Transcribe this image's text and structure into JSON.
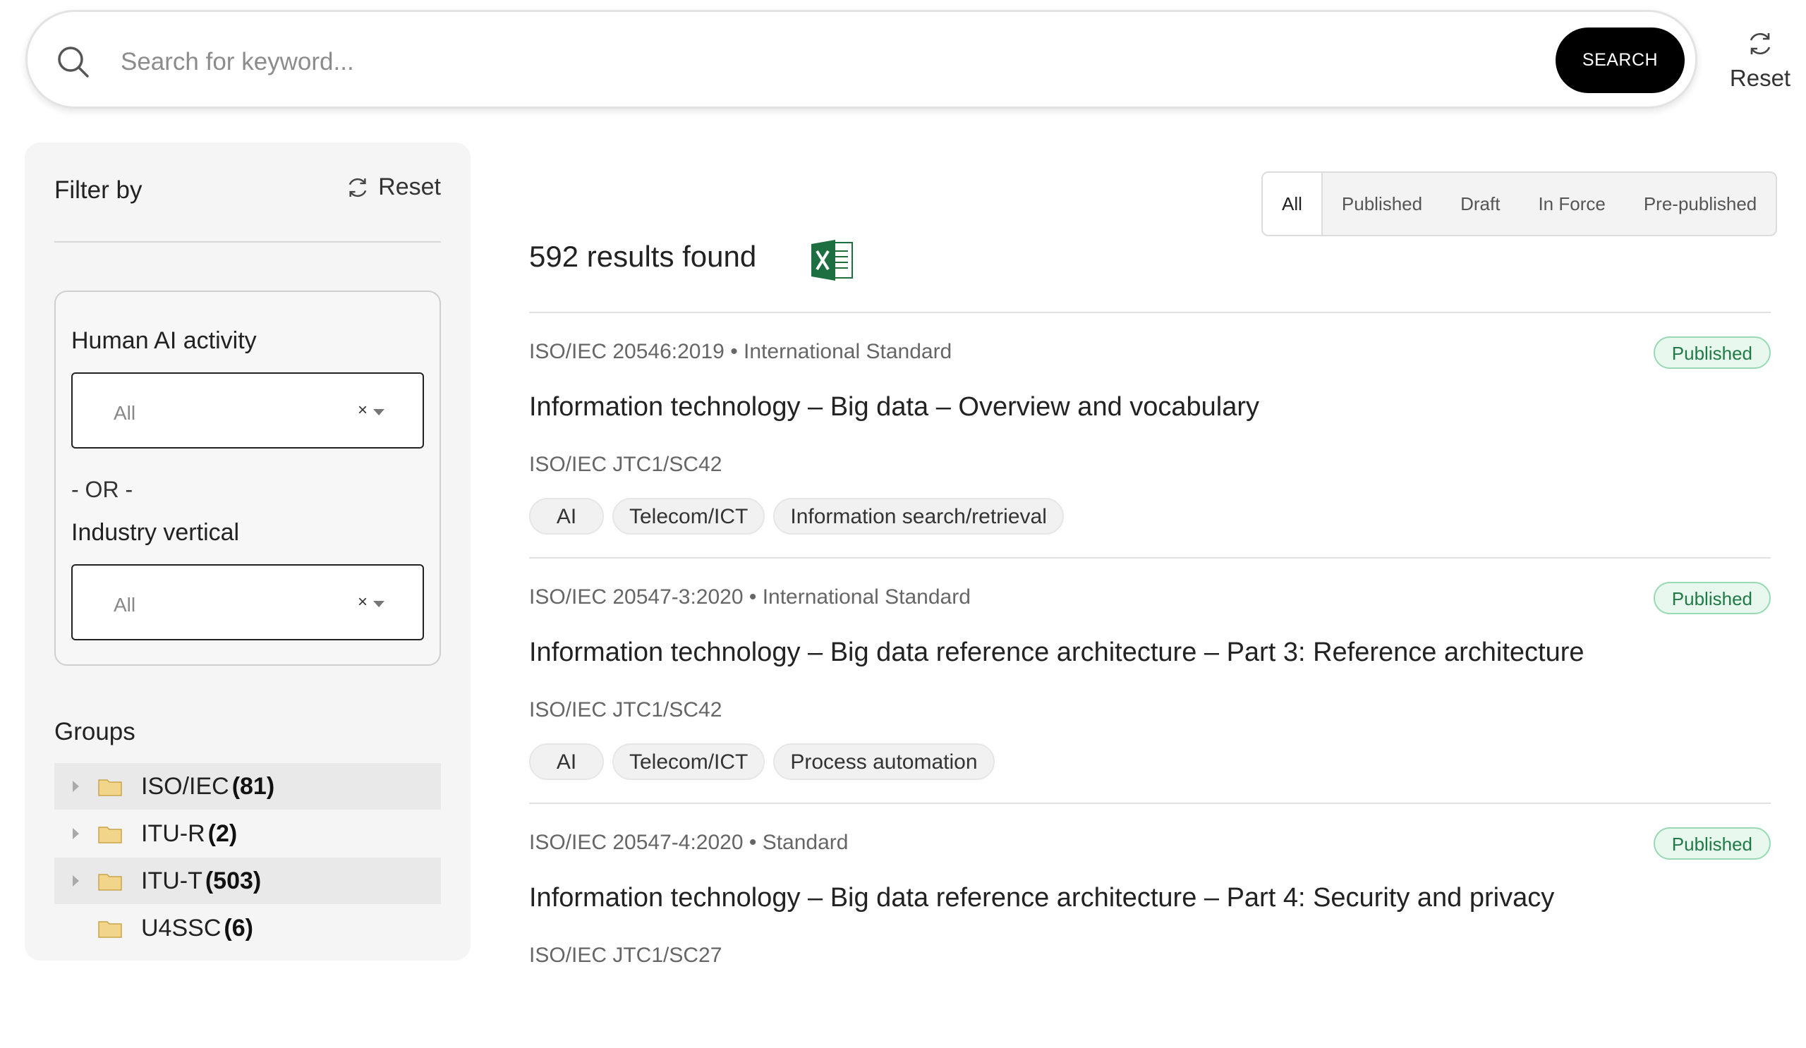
{
  "search": {
    "placeholder": "Search for keyword...",
    "button_label": "SEARCH",
    "reset_label": "Reset"
  },
  "sidebar": {
    "filter_title": "Filter by",
    "reset_label": "Reset",
    "human_ai_label": "Human AI activity",
    "human_ai_value": "All",
    "or_label": "- OR -",
    "industry_label": "Industry vertical",
    "industry_value": "All",
    "clear_symbol": "×",
    "groups_title": "Groups",
    "groups": [
      {
        "name": "ISO/IEC",
        "count": "(81)"
      },
      {
        "name": "ITU-R",
        "count": "(2)"
      },
      {
        "name": "ITU-T",
        "count": "(503)"
      },
      {
        "name": "U4SSC",
        "count": "(6)"
      }
    ]
  },
  "status_tabs": [
    "All",
    "Published",
    "Draft",
    "In Force",
    "Pre-published"
  ],
  "results_count": "592 results found",
  "results": [
    {
      "meta": "ISO/IEC 20546:2019 • International Standard",
      "status": "Published",
      "title": "Information technology – Big data – Overview and vocabulary",
      "committee": "ISO/IEC JTC1/SC42",
      "tags": [
        "AI",
        "Telecom/ICT",
        "Information search/retrieval"
      ]
    },
    {
      "meta": "ISO/IEC 20547-3:2020 • International Standard",
      "status": "Published",
      "title": "Information technology – Big data reference architecture – Part 3: Reference architecture",
      "committee": "ISO/IEC JTC1/SC42",
      "tags": [
        "AI",
        "Telecom/ICT",
        "Process automation"
      ]
    },
    {
      "meta": "ISO/IEC 20547-4:2020 • Standard",
      "status": "Published",
      "title": "Information technology – Big data reference architecture – Part 4: Security and privacy",
      "committee": "ISO/IEC JTC1/SC27",
      "tags": []
    }
  ],
  "colors": {
    "badge_text": "#1f7a45",
    "badge_bg": "#e9f8ef",
    "search_button": "#000000",
    "excel_green": "#1d6f42"
  }
}
